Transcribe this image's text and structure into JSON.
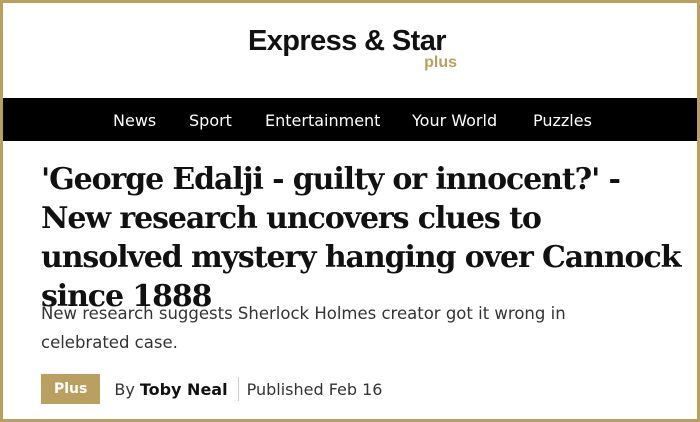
{
  "masthead": {
    "brand": "Express & Star",
    "sub_brand": "plus"
  },
  "nav": {
    "items": [
      {
        "label": "News"
      },
      {
        "label": "Sport"
      },
      {
        "label": "Entertainment"
      },
      {
        "label": "Your World"
      },
      {
        "label": "Puzzles"
      }
    ]
  },
  "article": {
    "headline": "'George Edalji - guilty or innocent?' - New research uncovers clues to unsolved mystery hanging over Cannock since 1888",
    "standfirst": "New research suggests Sherlock Holmes creator got it wrong in celebrated case.",
    "badge": "Plus",
    "by_label": "By",
    "author": "Toby Neal",
    "published": "Published Feb 16"
  },
  "colors": {
    "accent_gold": "#b9a060",
    "nav_background": "#000000",
    "text": "#111111"
  }
}
